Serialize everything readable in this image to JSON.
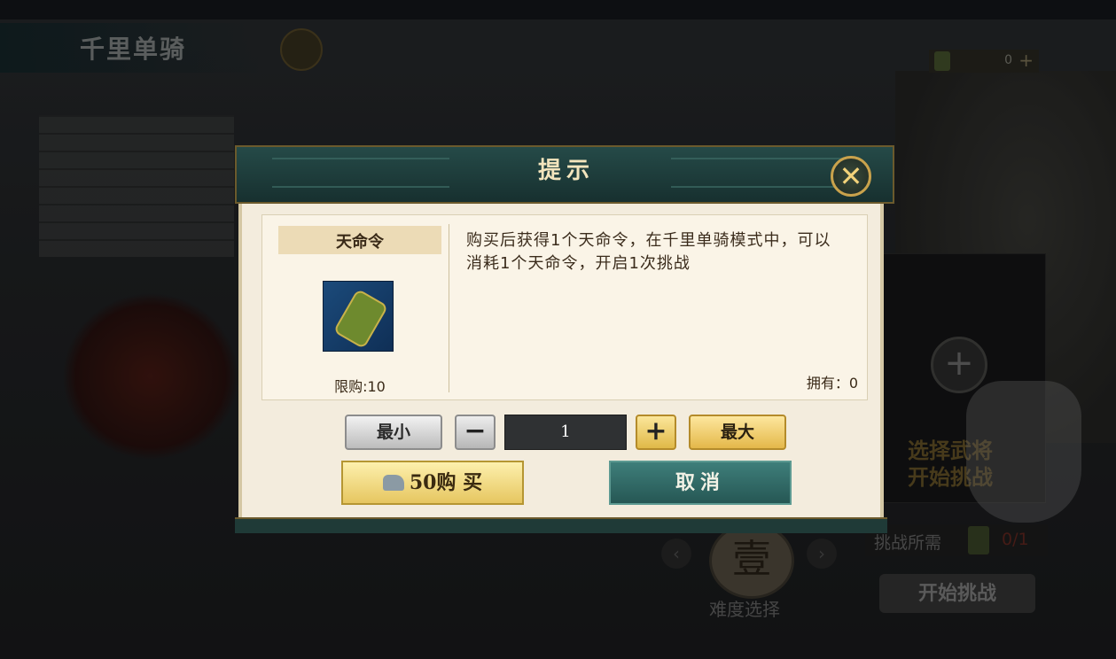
{
  "background": {
    "game_title": "千里单骑",
    "currency_count": "0",
    "select_general_line1": "选择武将",
    "select_general_line2": "开始挑战",
    "challenge_requirement_label": "挑战所需",
    "challenge_requirement_count": "0/1",
    "start_challenge": "开始挑战",
    "difficulty_numeral": "壹",
    "difficulty_label": "难度选择"
  },
  "dialog": {
    "title": "提示",
    "item_name": "天命令",
    "purchase_limit": "限购:10",
    "description": "购买后获得1个天命令，在千里单骑模式中，可以消耗1个天命令，开启1次挑战",
    "owned": "拥有：0",
    "min_label": "最小",
    "quantity": "1",
    "max_label": "最大",
    "buy_label": "50购 买",
    "cancel_label": "取消"
  },
  "colors": {
    "header_teal": "#254a48",
    "gold_button": "#e6c660",
    "cancel_teal": "#3e7e7a",
    "panel_cream": "#f3ecdd"
  }
}
